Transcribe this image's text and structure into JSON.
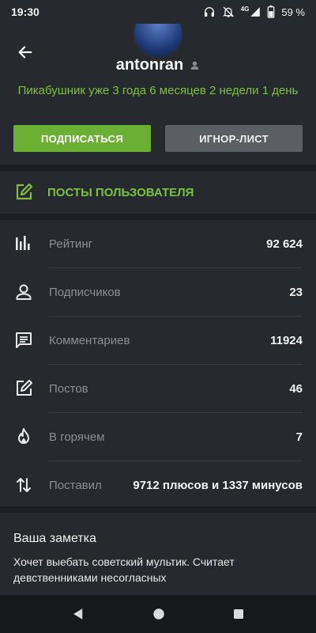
{
  "status_bar": {
    "time": "19:30",
    "network": "4G",
    "battery": "59 %",
    "icons": [
      "headphones-icon",
      "notifications-off-icon",
      "signal-icon",
      "battery-icon"
    ]
  },
  "header": {
    "username": "antonran",
    "since": "Пикабушник уже 3 года 6 месяцев 2 недели 1 день",
    "subscribe_label": "ПОДПИСАТЬСЯ",
    "ignore_label": "ИГНОР-ЛИСТ"
  },
  "posts_link": {
    "label": "ПОСТЫ ПОЛЬЗОВАТЕЛЯ"
  },
  "stats": [
    {
      "icon": "rating-icon",
      "label": "Рейтинг",
      "value": "92 624"
    },
    {
      "icon": "person-icon",
      "label": "Подписчиков",
      "value": "23"
    },
    {
      "icon": "comment-icon",
      "label": "Комментариев",
      "value": "11924"
    },
    {
      "icon": "edit-icon",
      "label": "Постов",
      "value": "46"
    },
    {
      "icon": "fire-icon",
      "label": "В горячем",
      "value": "7"
    },
    {
      "icon": "sort-arrows-icon",
      "label": "Поставил",
      "value": "9712 плюсов и 1337 минусов"
    }
  ],
  "note": {
    "title": "Ваша заметка",
    "text": "Хочет выебать советский мультик. Считает девственниками несогласных"
  },
  "colors": {
    "accent_green": "#6cb033",
    "background": "#1b1e22",
    "panel": "#26292d"
  }
}
